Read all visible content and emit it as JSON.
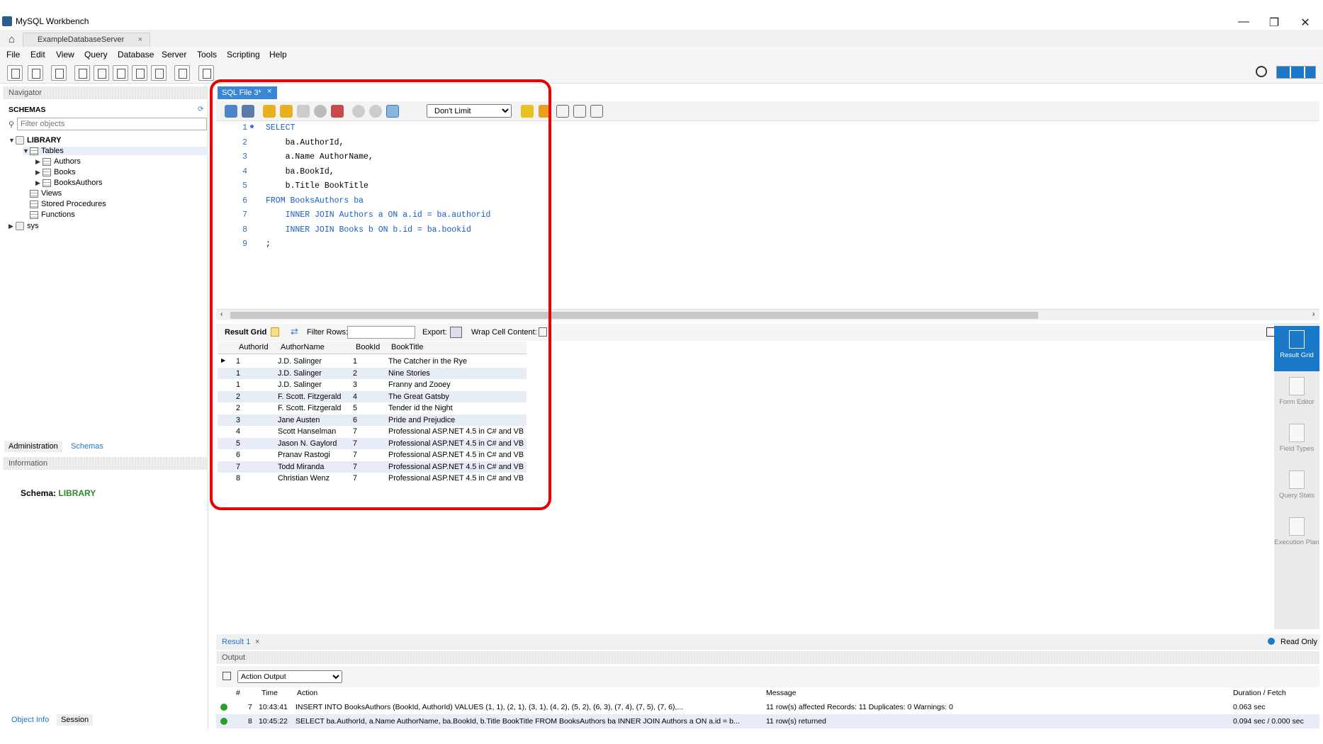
{
  "window": {
    "title": "MySQL Workbench",
    "minimize": "—",
    "maximize": "❐",
    "close": "✕"
  },
  "connection_tab": {
    "label": "ExampleDatabaseServer",
    "close": "×"
  },
  "menu": [
    "File",
    "Edit",
    "View",
    "Query",
    "Database",
    "Server",
    "Tools",
    "Scripting",
    "Help"
  ],
  "navigator": {
    "title": "Navigator",
    "schemas_label": "SCHEMAS",
    "filter_placeholder": "Filter objects",
    "tree": {
      "db": "LIBRARY",
      "tables": "Tables",
      "table_items": [
        "Authors",
        "Books",
        "BooksAuthors"
      ],
      "views": "Views",
      "procs": "Stored Procedures",
      "funcs": "Functions",
      "other_db": "sys"
    },
    "tabs": {
      "admin": "Administration",
      "schemas": "Schemas"
    },
    "info_title": "Information",
    "schema_label": "Schema:",
    "schema_value": "LIBRARY",
    "bottom_tabs": {
      "object_info": "Object Info",
      "session": "Session"
    }
  },
  "editor": {
    "tab_label": "SQL File 3*",
    "tab_close": "×",
    "limit": "Don't Limit",
    "lines": [
      {
        "n": "1",
        "text": "SELECT"
      },
      {
        "n": "2",
        "text": "    ba.AuthorId,"
      },
      {
        "n": "3",
        "text": "    a.Name AuthorName,"
      },
      {
        "n": "4",
        "text": "    ba.BookId,"
      },
      {
        "n": "5",
        "text": "    b.Title BookTitle"
      },
      {
        "n": "6",
        "text": "FROM BooksAuthors ba"
      },
      {
        "n": "7",
        "text": "    INNER JOIN Authors a ON a.id = ba.authorid"
      },
      {
        "n": "8",
        "text": "    INNER JOIN Books b ON b.id = ba.bookid"
      },
      {
        "n": "9",
        "text": ";"
      }
    ]
  },
  "result": {
    "grid_label": "Result Grid",
    "filter_label": "Filter Rows:",
    "export_label": "Export:",
    "wrap_label": "Wrap Cell Content:",
    "columns": [
      "AuthorId",
      "AuthorName",
      "BookId",
      "BookTitle"
    ],
    "rows": [
      [
        "1",
        "J.D. Salinger",
        "1",
        "The Catcher in the Rye"
      ],
      [
        "1",
        "J.D. Salinger",
        "2",
        "Nine Stories"
      ],
      [
        "1",
        "J.D. Salinger",
        "3",
        "Franny and Zooey"
      ],
      [
        "2",
        "F. Scott. Fitzgerald",
        "4",
        "The Great Gatsby"
      ],
      [
        "2",
        "F. Scott. Fitzgerald",
        "5",
        "Tender id the Night"
      ],
      [
        "3",
        "Jane Austen",
        "6",
        "Pride and Prejudice"
      ],
      [
        "4",
        "Scott Hanselman",
        "7",
        "Professional ASP.NET 4.5 in C# and VB"
      ],
      [
        "5",
        "Jason N. Gaylord",
        "7",
        "Professional ASP.NET 4.5 in C# and VB"
      ],
      [
        "6",
        "Pranav Rastogi",
        "7",
        "Professional ASP.NET 4.5 in C# and VB"
      ],
      [
        "7",
        "Todd Miranda",
        "7",
        "Professional ASP.NET 4.5 in C# and VB"
      ],
      [
        "8",
        "Christian Wenz",
        "7",
        "Professional ASP.NET 4.5 in C# and VB"
      ]
    ],
    "side_panel": {
      "result_grid": "Result Grid",
      "form_editor": "Form Editor",
      "field_types": "Field Types",
      "query_stats": "Query Stats",
      "execution_plan": "Execution Plan"
    },
    "tab_label": "Result 1",
    "tab_close": "×",
    "read_only": "Read Only"
  },
  "output": {
    "title": "Output",
    "selector": "Action Output",
    "columns": {
      "num": "#",
      "time": "Time",
      "action": "Action",
      "message": "Message",
      "duration": "Duration / Fetch"
    },
    "rows": [
      {
        "num": "7",
        "time": "10:43:41",
        "action": "INSERT INTO BooksAuthors    (BookId, AuthorId) VALUES    (1, 1),    (2, 1),    (3, 1),    (4, 2),    (5, 2),    (6, 3),    (7, 4),    (7, 5),    (7, 6),...",
        "message": "11 row(s) affected Records: 11  Duplicates: 0  Warnings: 0",
        "duration": "0.063 sec"
      },
      {
        "num": "8",
        "time": "10:45:22",
        "action": "SELECT  ba.AuthorId,   a.Name AuthorName,   ba.BookId,   b.Title BookTitle FROM BooksAuthors ba    INNER JOIN Authors a ON a.id = b...",
        "message": "11 row(s) returned",
        "duration": "0.094 sec / 0.000 sec"
      }
    ]
  },
  "colors": {
    "accent": "#1a78c8",
    "highlight": "#e60000",
    "keyword": "#1a5dc8",
    "schema_value": "#2a8a2a"
  }
}
